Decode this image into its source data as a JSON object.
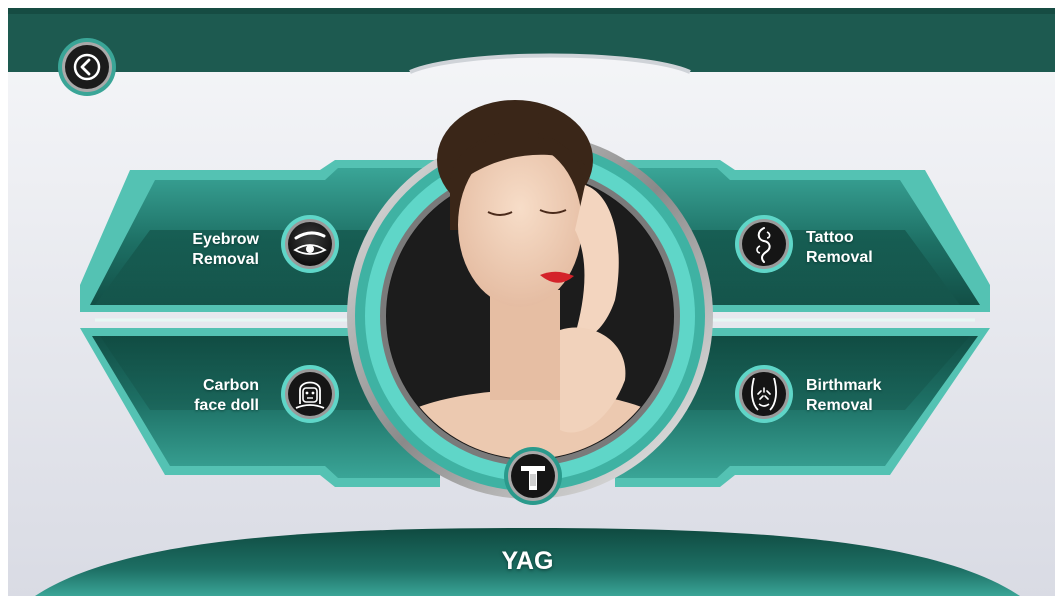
{
  "header": {
    "back_button": "back-icon"
  },
  "treatments": [
    {
      "line1": "Eyebrow",
      "line2": "Removal",
      "icon": "eye-icon"
    },
    {
      "line1": "Tattoo",
      "line2": "Removal",
      "icon": "tattoo-icon"
    },
    {
      "line1": "Carbon",
      "line2": "face doll",
      "icon": "face-mask-icon"
    },
    {
      "line1": "Birthmark",
      "line2": "Removal",
      "icon": "birthmark-icon"
    }
  ],
  "center": {
    "handpiece_icon": "handpiece-icon"
  },
  "footer": {
    "mode": "YAG"
  },
  "colors": {
    "dark_teal": "#0f4a40",
    "teal": "#2a9a8c",
    "bright_teal": "#5fd6c8",
    "background": "#eef0f4"
  }
}
